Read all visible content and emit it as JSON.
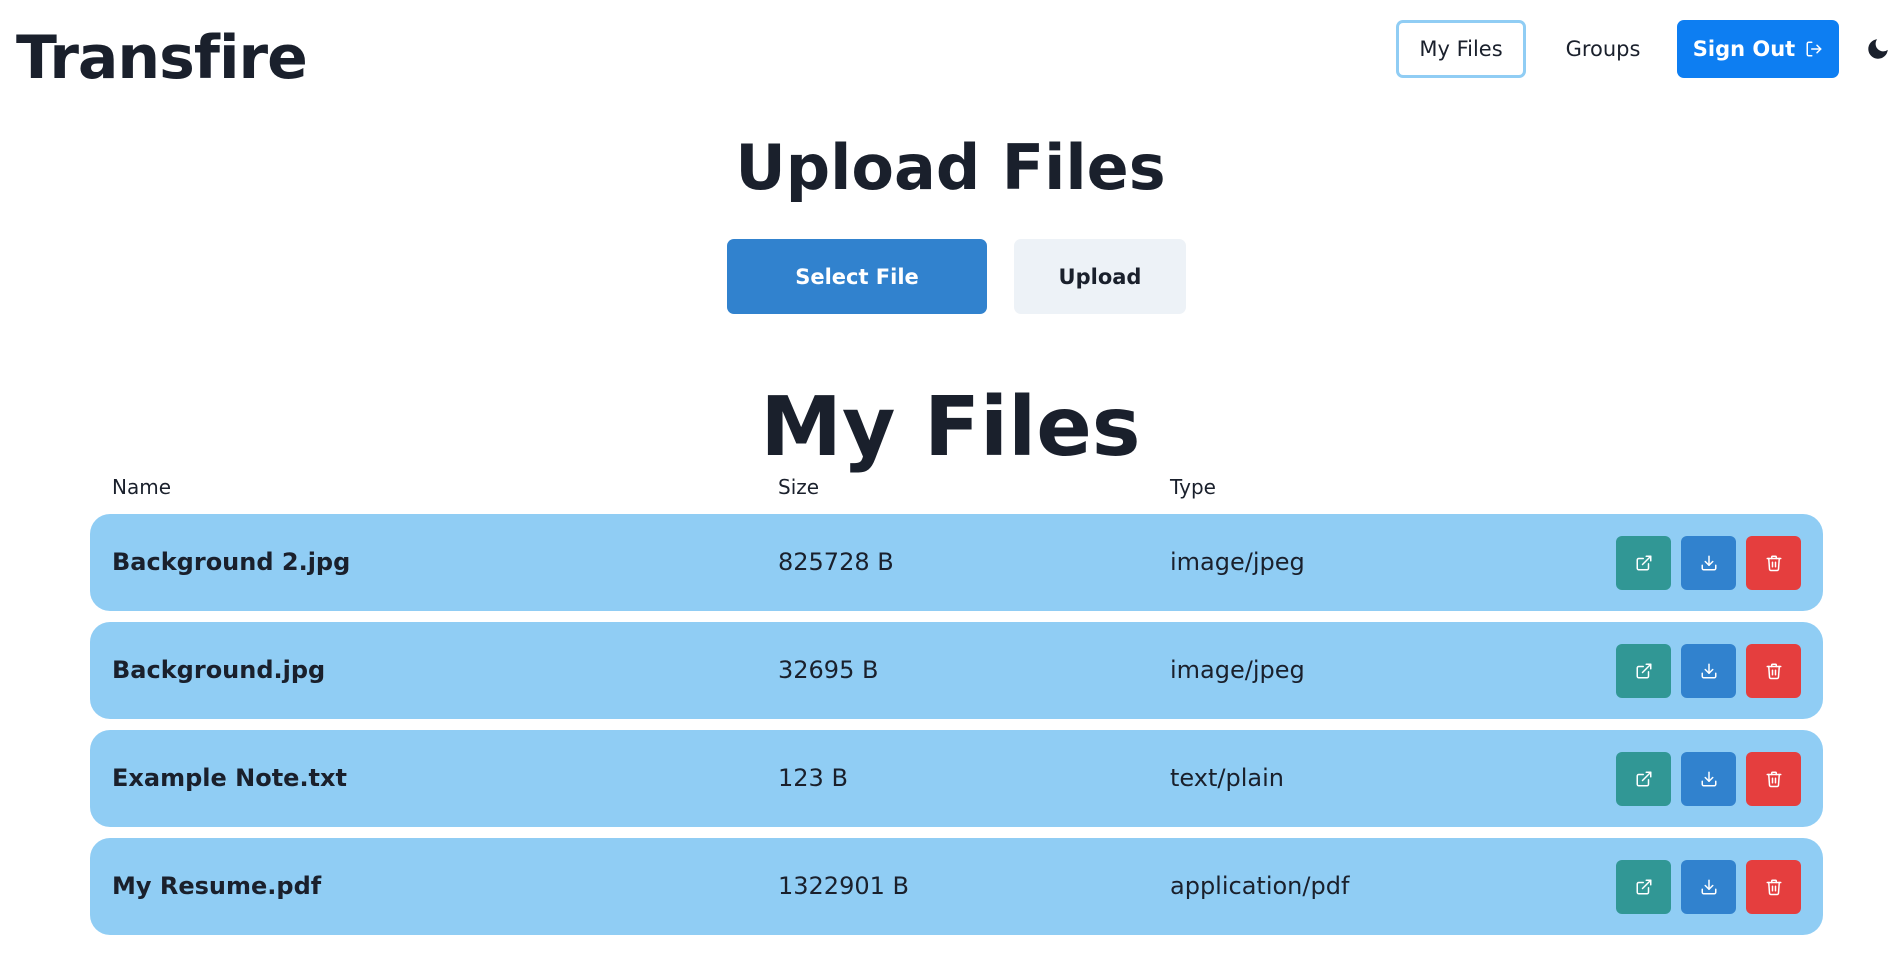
{
  "app": {
    "title": "Transfire"
  },
  "nav": {
    "my_files_label": "My Files",
    "groups_label": "Groups",
    "sign_out_label": "Sign Out",
    "sign_out_icon": "sign-out-icon",
    "theme_toggle_icon": "moon-icon"
  },
  "upload": {
    "title": "Upload Files",
    "select_label": "Select File",
    "upload_label": "Upload"
  },
  "files": {
    "title": "My Files",
    "columns": {
      "name": "Name",
      "size": "Size",
      "type": "Type"
    },
    "rows": [
      {
        "name": "Background 2.jpg",
        "size": "825728 B",
        "type": "image/jpeg"
      },
      {
        "name": "Background.jpg",
        "size": "32695 B",
        "type": "image/jpeg"
      },
      {
        "name": "Example Note.txt",
        "size": "123 B",
        "type": "text/plain"
      },
      {
        "name": "My Resume.pdf",
        "size": "1322901 B",
        "type": "application/pdf"
      }
    ],
    "action_icons": [
      "external-link-icon",
      "download-icon",
      "trash-icon"
    ]
  },
  "colors": {
    "primary": "#3182ce",
    "sign_out": "#0d7ef2",
    "row_bg": "#90cdf4",
    "open_action": "#319795",
    "delete_action": "#e53e3e",
    "text": "#1a202c"
  }
}
